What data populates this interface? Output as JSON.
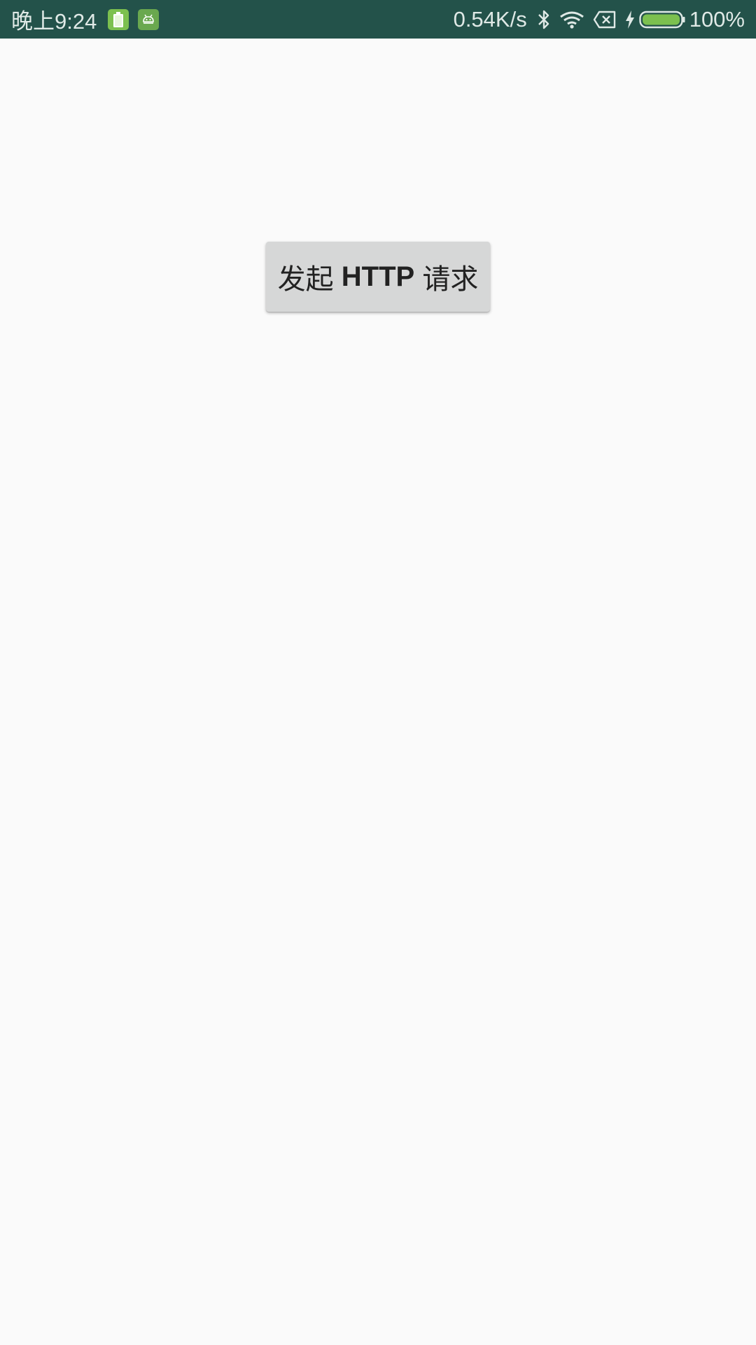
{
  "status_bar": {
    "time": "晚上9:24",
    "network_speed": "0.54K/s",
    "battery_percent": "100%",
    "background_color": "#23524a",
    "battery_fill_color": "#7cc04f",
    "icons": [
      "battery-app-icon",
      "android-app-icon",
      "bluetooth-icon",
      "wifi-icon",
      "no-sim-icon",
      "charging-bolt-icon",
      "battery-icon"
    ]
  },
  "main": {
    "button": {
      "prefix": "发起 ",
      "bold": "HTTP",
      "suffix": " 请求",
      "background_color": "#d6d7d7"
    }
  }
}
